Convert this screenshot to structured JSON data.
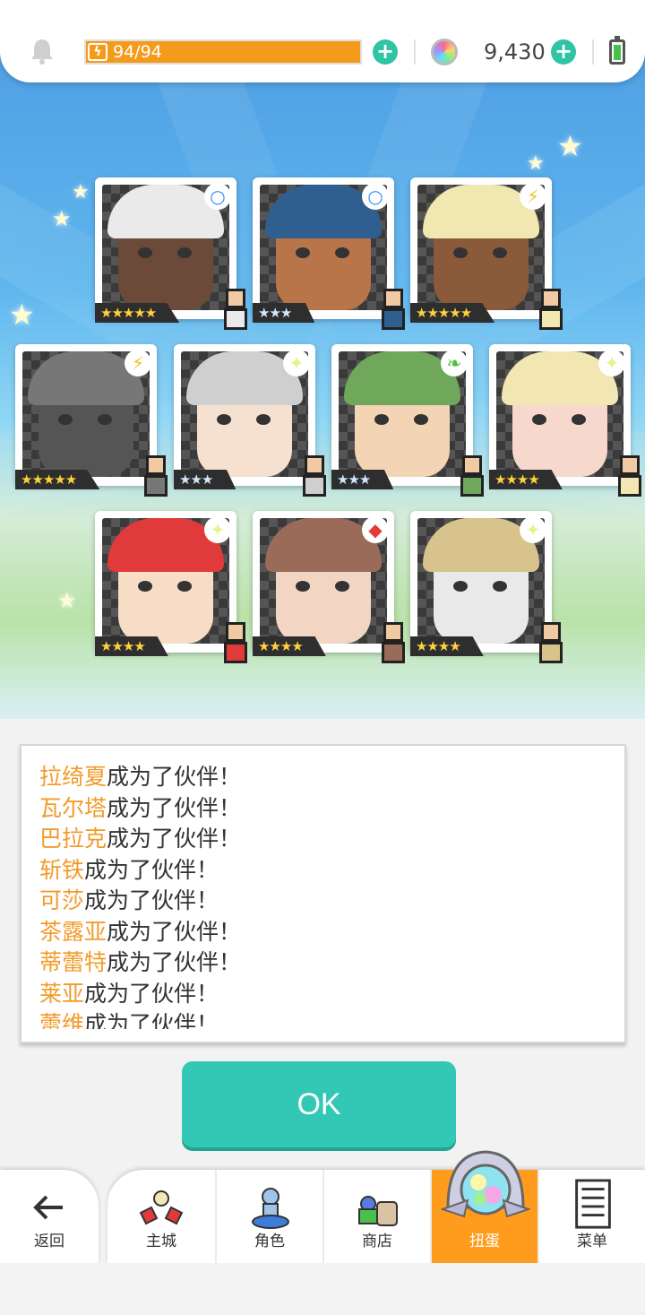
{
  "status": {
    "energy_text": "94/94",
    "energy_fraction": 1.0,
    "gem_count": "9,430"
  },
  "cards": [
    {
      "rarity": "★★★★★",
      "element": "○",
      "element_color": "#2f8cff",
      "hair": "#eaeaea",
      "skin": "#6b4a3a"
    },
    {
      "rarity": "★★★",
      "element": "○",
      "element_color": "#2f8cff",
      "hair": "#2f5f8f",
      "skin": "#b8754a"
    },
    {
      "rarity": "★★★★★",
      "element": "⚡",
      "element_color": "#f3c21a",
      "hair": "#f1e7b0",
      "skin": "#8a5a3a"
    },
    {
      "rarity": "★★★★★",
      "element": "⚡",
      "element_color": "#f3c21a",
      "hair": "#777",
      "skin": "#555"
    },
    {
      "rarity": "★★★",
      "element": "✦",
      "element_color": "#e8f28a",
      "hair": "#cfcfcf",
      "skin": "#f6e1d0"
    },
    {
      "rarity": "★★★",
      "element": "❧",
      "element_color": "#4bbf3c",
      "hair": "#6fa85a",
      "skin": "#f3d5b5"
    },
    {
      "rarity": "★★★★",
      "element": "✦",
      "element_color": "#e8f28a",
      "hair": "#f2e6b3",
      "skin": "#f6d9cc"
    },
    {
      "rarity": "★★★★",
      "element": "✦",
      "element_color": "#e8f28a",
      "hair": "#e03a3a",
      "skin": "#f7dcc6"
    },
    {
      "rarity": "★★★★",
      "element": "◆",
      "element_color": "#e23a3a",
      "hair": "#9b6b5a",
      "skin": "#f3d5c3"
    },
    {
      "rarity": "★★★★",
      "element": "✦",
      "element_color": "#e8f28a",
      "hair": "#d8c38c",
      "skin": "#e9e9e9"
    }
  ],
  "messages": [
    {
      "name": "拉绮夏",
      "text": "成为了伙伴！"
    },
    {
      "name": "瓦尔塔",
      "text": "成为了伙伴！"
    },
    {
      "name": "巴拉克",
      "text": "成为了伙伴！"
    },
    {
      "name": "斩铁",
      "text": "成为了伙伴！"
    },
    {
      "name": "可莎",
      "text": "成为了伙伴！"
    },
    {
      "name": "茶露亚",
      "text": "成为了伙伴！"
    },
    {
      "name": "蒂蕾特",
      "text": "成为了伙伴！"
    },
    {
      "name": "莱亚",
      "text": "成为了伙伴！"
    },
    {
      "name": "蕾维",
      "text": "成为了伙伴！"
    }
  ],
  "ok_label": "OK",
  "nav": {
    "back_label": "返回",
    "tabs": [
      {
        "label": "主城",
        "icon": "castle-icon"
      },
      {
        "label": "角色",
        "icon": "hero-statue-icon"
      },
      {
        "label": "商店",
        "icon": "shop-bag-icon"
      },
      {
        "label": "扭蛋",
        "icon": "gacha-orb-icon"
      },
      {
        "label": "菜单",
        "icon": "menu-list-icon"
      }
    ],
    "active_tab": "扭蛋"
  }
}
